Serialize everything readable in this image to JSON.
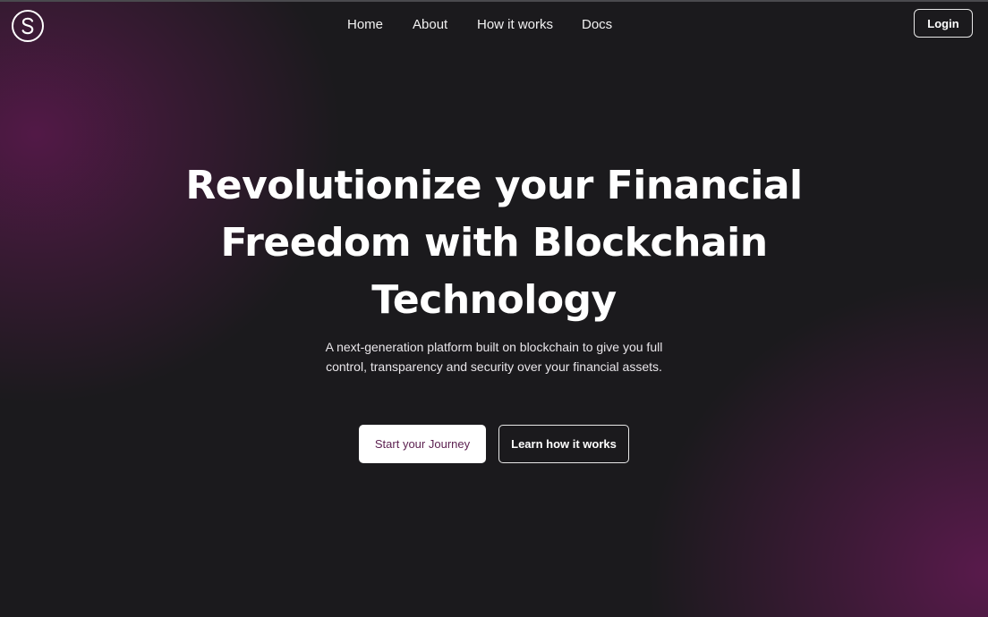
{
  "header": {
    "logo_icon": "s-circle-logo-icon",
    "nav": [
      {
        "label": "Home"
      },
      {
        "label": "About"
      },
      {
        "label": "How it works"
      },
      {
        "label": "Docs"
      }
    ],
    "login_label": "Login"
  },
  "hero": {
    "title_lines": [
      "Revolutionize your Financial",
      "Freedom with Blockchain",
      "Technology"
    ],
    "subtitle_lines": [
      "A next-generation platform built on blockchain to give you full",
      "control, transparency and security over your financial assets."
    ],
    "primary_cta": "Start your Journey",
    "secondary_cta": "Learn how it works"
  },
  "colors": {
    "background": "#1b1a1d",
    "accent_glow": "#5c194e",
    "primary_button_text": "#5b1f4f",
    "text": "#ffffff"
  }
}
